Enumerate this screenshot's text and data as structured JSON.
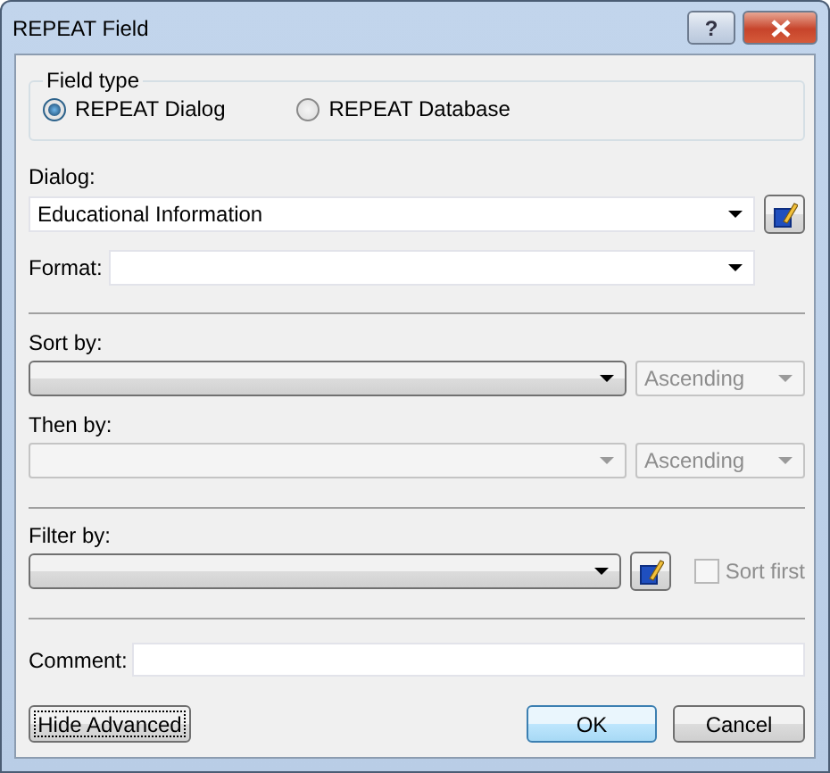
{
  "window": {
    "title": "REPEAT Field"
  },
  "title_buttons": [
    {
      "kind": "help",
      "label": "?"
    },
    {
      "kind": "close"
    }
  ],
  "field_type": {
    "label": "Field type",
    "options": [
      {
        "label": "REPEAT Dialog",
        "selected": true
      },
      {
        "label": "REPEAT Database",
        "selected": false
      }
    ]
  },
  "dialog": {
    "label": "Dialog:",
    "value": "Educational Information"
  },
  "format": {
    "label": "Format:"
  },
  "sort_rows": [
    {
      "label": "Sort by:",
      "disabled": false,
      "order": "Ascending",
      "order_disabled": true
    },
    {
      "label": "Then by:",
      "disabled": true,
      "order": "Ascending",
      "order_disabled": true
    }
  ],
  "filter": {
    "label": "Filter by:",
    "sort_first": {
      "label": "Sort first",
      "checked": false,
      "disabled": true
    }
  },
  "comment": {
    "label": "Comment:"
  },
  "advanced_button": {
    "label": "Hide Advanced",
    "focused": true
  },
  "buttons": [
    {
      "label": "OK",
      "default": true
    },
    {
      "label": "Cancel",
      "default": false
    }
  ]
}
